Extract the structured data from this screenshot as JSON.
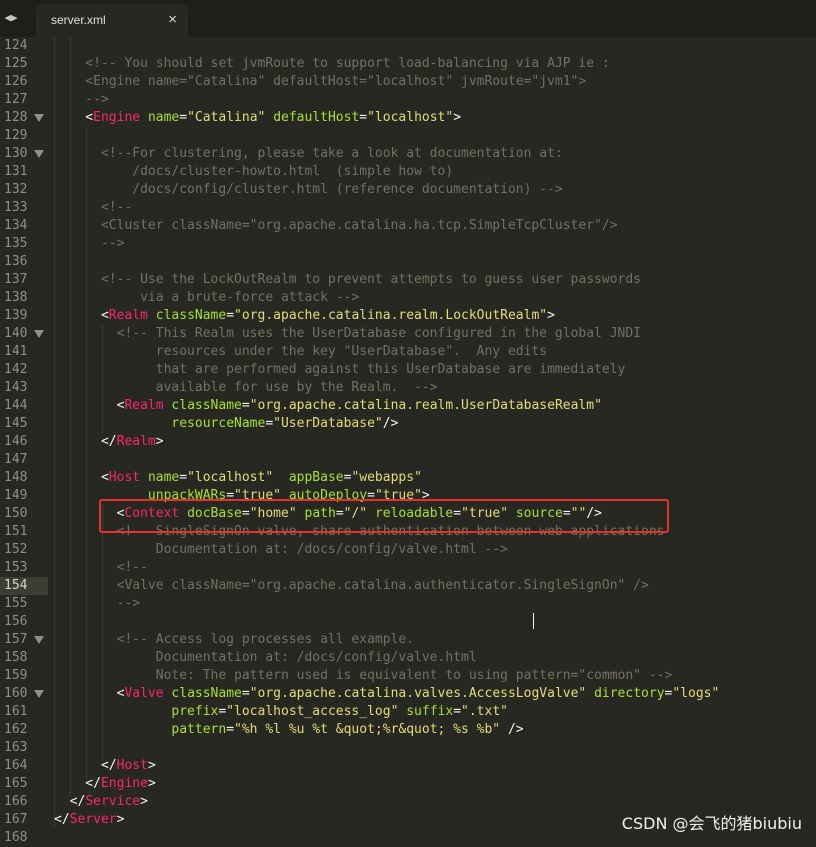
{
  "tabs": [
    {
      "label": "server.xml",
      "close": "×"
    }
  ],
  "lines": [
    {
      "n": "124",
      "fold": false,
      "tokens": []
    },
    {
      "n": "125",
      "fold": false,
      "tokens": [
        [
          "c",
          "    <!-- You should set jvmRoute to support load-balancing via AJP ie :"
        ]
      ]
    },
    {
      "n": "126",
      "fold": false,
      "tokens": [
        [
          "c",
          "    <Engine name=\"Catalina\" defaultHost=\"localhost\" jvmRoute=\"jvm1\">"
        ]
      ]
    },
    {
      "n": "127",
      "fold": false,
      "tokens": [
        [
          "c",
          "    -->"
        ]
      ]
    },
    {
      "n": "128",
      "fold": true,
      "tokens": [
        [
          "p",
          "    <"
        ],
        [
          "t",
          "Engine"
        ],
        [
          "p",
          " "
        ],
        [
          "a",
          "name"
        ],
        [
          "p",
          "="
        ],
        [
          "s",
          "\"Catalina\""
        ],
        [
          "p",
          " "
        ],
        [
          "a",
          "defaultHost"
        ],
        [
          "p",
          "="
        ],
        [
          "s",
          "\"localhost\""
        ],
        [
          "p",
          ">"
        ]
      ]
    },
    {
      "n": "129",
      "fold": false,
      "tokens": []
    },
    {
      "n": "130",
      "fold": true,
      "tokens": [
        [
          "c",
          "      <!--For clustering, please take a look at documentation at:"
        ]
      ]
    },
    {
      "n": "131",
      "fold": false,
      "tokens": [
        [
          "c",
          "          /docs/cluster-howto.html  (simple how to)"
        ]
      ]
    },
    {
      "n": "132",
      "fold": false,
      "tokens": [
        [
          "c",
          "          /docs/config/cluster.html (reference documentation) -->"
        ]
      ]
    },
    {
      "n": "133",
      "fold": false,
      "tokens": [
        [
          "c",
          "      <!--"
        ]
      ]
    },
    {
      "n": "134",
      "fold": false,
      "tokens": [
        [
          "c",
          "      <Cluster className=\"org.apache.catalina.ha.tcp.SimpleTcpCluster\"/>"
        ]
      ]
    },
    {
      "n": "135",
      "fold": false,
      "tokens": [
        [
          "c",
          "      -->"
        ]
      ]
    },
    {
      "n": "136",
      "fold": false,
      "tokens": []
    },
    {
      "n": "137",
      "fold": false,
      "tokens": [
        [
          "c",
          "      <!-- Use the LockOutRealm to prevent attempts to guess user passwords"
        ]
      ]
    },
    {
      "n": "138",
      "fold": false,
      "tokens": [
        [
          "c",
          "           via a brute-force attack -->"
        ]
      ]
    },
    {
      "n": "139",
      "fold": false,
      "tokens": [
        [
          "p",
          "      <"
        ],
        [
          "t",
          "Realm"
        ],
        [
          "p",
          " "
        ],
        [
          "a",
          "className"
        ],
        [
          "p",
          "="
        ],
        [
          "s",
          "\"org.apache.catalina.realm.LockOutRealm\""
        ],
        [
          "p",
          ">"
        ]
      ]
    },
    {
      "n": "140",
      "fold": true,
      "tokens": [
        [
          "c",
          "        <!-- This Realm uses the UserDatabase configured in the global JNDI"
        ]
      ]
    },
    {
      "n": "141",
      "fold": false,
      "tokens": [
        [
          "c",
          "             resources under the key \"UserDatabase\".  Any edits"
        ]
      ]
    },
    {
      "n": "142",
      "fold": false,
      "tokens": [
        [
          "c",
          "             that are performed against this UserDatabase are immediately"
        ]
      ]
    },
    {
      "n": "143",
      "fold": false,
      "tokens": [
        [
          "c",
          "             available for use by the Realm.  -->"
        ]
      ]
    },
    {
      "n": "144",
      "fold": false,
      "tokens": [
        [
          "p",
          "        <"
        ],
        [
          "t",
          "Realm"
        ],
        [
          "p",
          " "
        ],
        [
          "a",
          "className"
        ],
        [
          "p",
          "="
        ],
        [
          "s",
          "\"org.apache.catalina.realm.UserDatabaseRealm\""
        ]
      ]
    },
    {
      "n": "145",
      "fold": false,
      "tokens": [
        [
          "p",
          "               "
        ],
        [
          "a",
          "resourceName"
        ],
        [
          "p",
          "="
        ],
        [
          "s",
          "\"UserDatabase\""
        ],
        [
          "p",
          "/>"
        ]
      ]
    },
    {
      "n": "146",
      "fold": false,
      "tokens": [
        [
          "p",
          "      </"
        ],
        [
          "t",
          "Realm"
        ],
        [
          "p",
          ">"
        ]
      ]
    },
    {
      "n": "147",
      "fold": false,
      "tokens": []
    },
    {
      "n": "148",
      "fold": false,
      "tokens": [
        [
          "p",
          "      <"
        ],
        [
          "t",
          "Host"
        ],
        [
          "p",
          " "
        ],
        [
          "a",
          "name"
        ],
        [
          "p",
          "="
        ],
        [
          "s",
          "\"localhost\""
        ],
        [
          "p",
          "  "
        ],
        [
          "a",
          "appBase"
        ],
        [
          "p",
          "="
        ],
        [
          "s",
          "\"webapps\""
        ]
      ]
    },
    {
      "n": "149",
      "fold": false,
      "tokens": [
        [
          "p",
          "            "
        ],
        [
          "a",
          "unpackWARs"
        ],
        [
          "p",
          "="
        ],
        [
          "s",
          "\"true\""
        ],
        [
          "p",
          " "
        ],
        [
          "a",
          "autoDeploy"
        ],
        [
          "p",
          "="
        ],
        [
          "s",
          "\"true\""
        ],
        [
          "p",
          ">"
        ]
      ]
    },
    {
      "n": "150",
      "fold": false,
      "tokens": [
        [
          "p",
          "        <"
        ],
        [
          "t",
          "Context"
        ],
        [
          "p",
          " "
        ],
        [
          "a",
          "docBase"
        ],
        [
          "p",
          "="
        ],
        [
          "s",
          "\"home\""
        ],
        [
          "p",
          " "
        ],
        [
          "a",
          "path"
        ],
        [
          "p",
          "="
        ],
        [
          "s",
          "\"/\""
        ],
        [
          "p",
          " "
        ],
        [
          "a",
          "reloadable"
        ],
        [
          "p",
          "="
        ],
        [
          "s",
          "\"true\""
        ],
        [
          "p",
          " "
        ],
        [
          "a",
          "source"
        ],
        [
          "p",
          "="
        ],
        [
          "s",
          "\"\""
        ],
        [
          "p",
          "/>"
        ]
      ]
    },
    {
      "n": "151",
      "fold": false,
      "tokens": [
        [
          "c",
          "        <!-- SingleSignOn valve, share authentication between web applications"
        ]
      ]
    },
    {
      "n": "152",
      "fold": false,
      "tokens": [
        [
          "c",
          "             Documentation at: /docs/config/valve.html -->"
        ]
      ]
    },
    {
      "n": "153",
      "fold": false,
      "tokens": [
        [
          "c",
          "        <!--"
        ]
      ]
    },
    {
      "n": "154",
      "fold": false,
      "tokens": [
        [
          "c",
          "        <Valve className=\"org.apache.catalina.authenticator.SingleSignOn\" />"
        ]
      ]
    },
    {
      "n": "155",
      "fold": false,
      "tokens": [
        [
          "c",
          "        -->"
        ]
      ]
    },
    {
      "n": "156",
      "fold": false,
      "tokens": []
    },
    {
      "n": "157",
      "fold": true,
      "tokens": [
        [
          "c",
          "        <!-- Access log processes all example."
        ]
      ]
    },
    {
      "n": "158",
      "fold": false,
      "tokens": [
        [
          "c",
          "             Documentation at: /docs/config/valve.html"
        ]
      ]
    },
    {
      "n": "159",
      "fold": false,
      "tokens": [
        [
          "c",
          "             Note: The pattern used is equivalent to using pattern=\"common\" -->"
        ]
      ]
    },
    {
      "n": "160",
      "fold": true,
      "tokens": [
        [
          "p",
          "        <"
        ],
        [
          "t",
          "Valve"
        ],
        [
          "p",
          " "
        ],
        [
          "a",
          "className"
        ],
        [
          "p",
          "="
        ],
        [
          "s",
          "\"org.apache.catalina.valves.AccessLogValve\""
        ],
        [
          "p",
          " "
        ],
        [
          "a",
          "directory"
        ],
        [
          "p",
          "="
        ],
        [
          "s",
          "\"logs\""
        ]
      ]
    },
    {
      "n": "161",
      "fold": false,
      "tokens": [
        [
          "p",
          "               "
        ],
        [
          "a",
          "prefix"
        ],
        [
          "p",
          "="
        ],
        [
          "s",
          "\"localhost_access_log\""
        ],
        [
          "p",
          " "
        ],
        [
          "a",
          "suffix"
        ],
        [
          "p",
          "="
        ],
        [
          "s",
          "\".txt\""
        ]
      ]
    },
    {
      "n": "162",
      "fold": false,
      "tokens": [
        [
          "p",
          "               "
        ],
        [
          "a",
          "pattern"
        ],
        [
          "p",
          "="
        ],
        [
          "s",
          "\"%h %l %u %t &quot;%r&quot; %s %b\""
        ],
        [
          "p",
          " />"
        ]
      ]
    },
    {
      "n": "163",
      "fold": false,
      "tokens": []
    },
    {
      "n": "164",
      "fold": false,
      "tokens": [
        [
          "p",
          "      </"
        ],
        [
          "t",
          "Host"
        ],
        [
          "p",
          ">"
        ]
      ]
    },
    {
      "n": "165",
      "fold": false,
      "tokens": [
        [
          "p",
          "    </"
        ],
        [
          "t",
          "Engine"
        ],
        [
          "p",
          ">"
        ]
      ]
    },
    {
      "n": "166",
      "fold": false,
      "tokens": [
        [
          "p",
          "  </"
        ],
        [
          "t",
          "Service"
        ],
        [
          "p",
          ">"
        ]
      ]
    },
    {
      "n": "167",
      "fold": false,
      "tokens": [
        [
          "p",
          "</"
        ],
        [
          "t",
          "Server"
        ],
        [
          "p",
          ">"
        ]
      ]
    },
    {
      "n": "168",
      "fold": false,
      "tokens": []
    }
  ],
  "current_line": "154",
  "watermark": "CSDN @会飞的猪biubiu",
  "colors": {
    "background": "#272822",
    "comment": "#75715e",
    "tag": "#f92672",
    "attribute": "#a6e22e",
    "string": "#e6db74",
    "punctuation": "#f8f8f2",
    "annotation_box": "#e5322d"
  }
}
